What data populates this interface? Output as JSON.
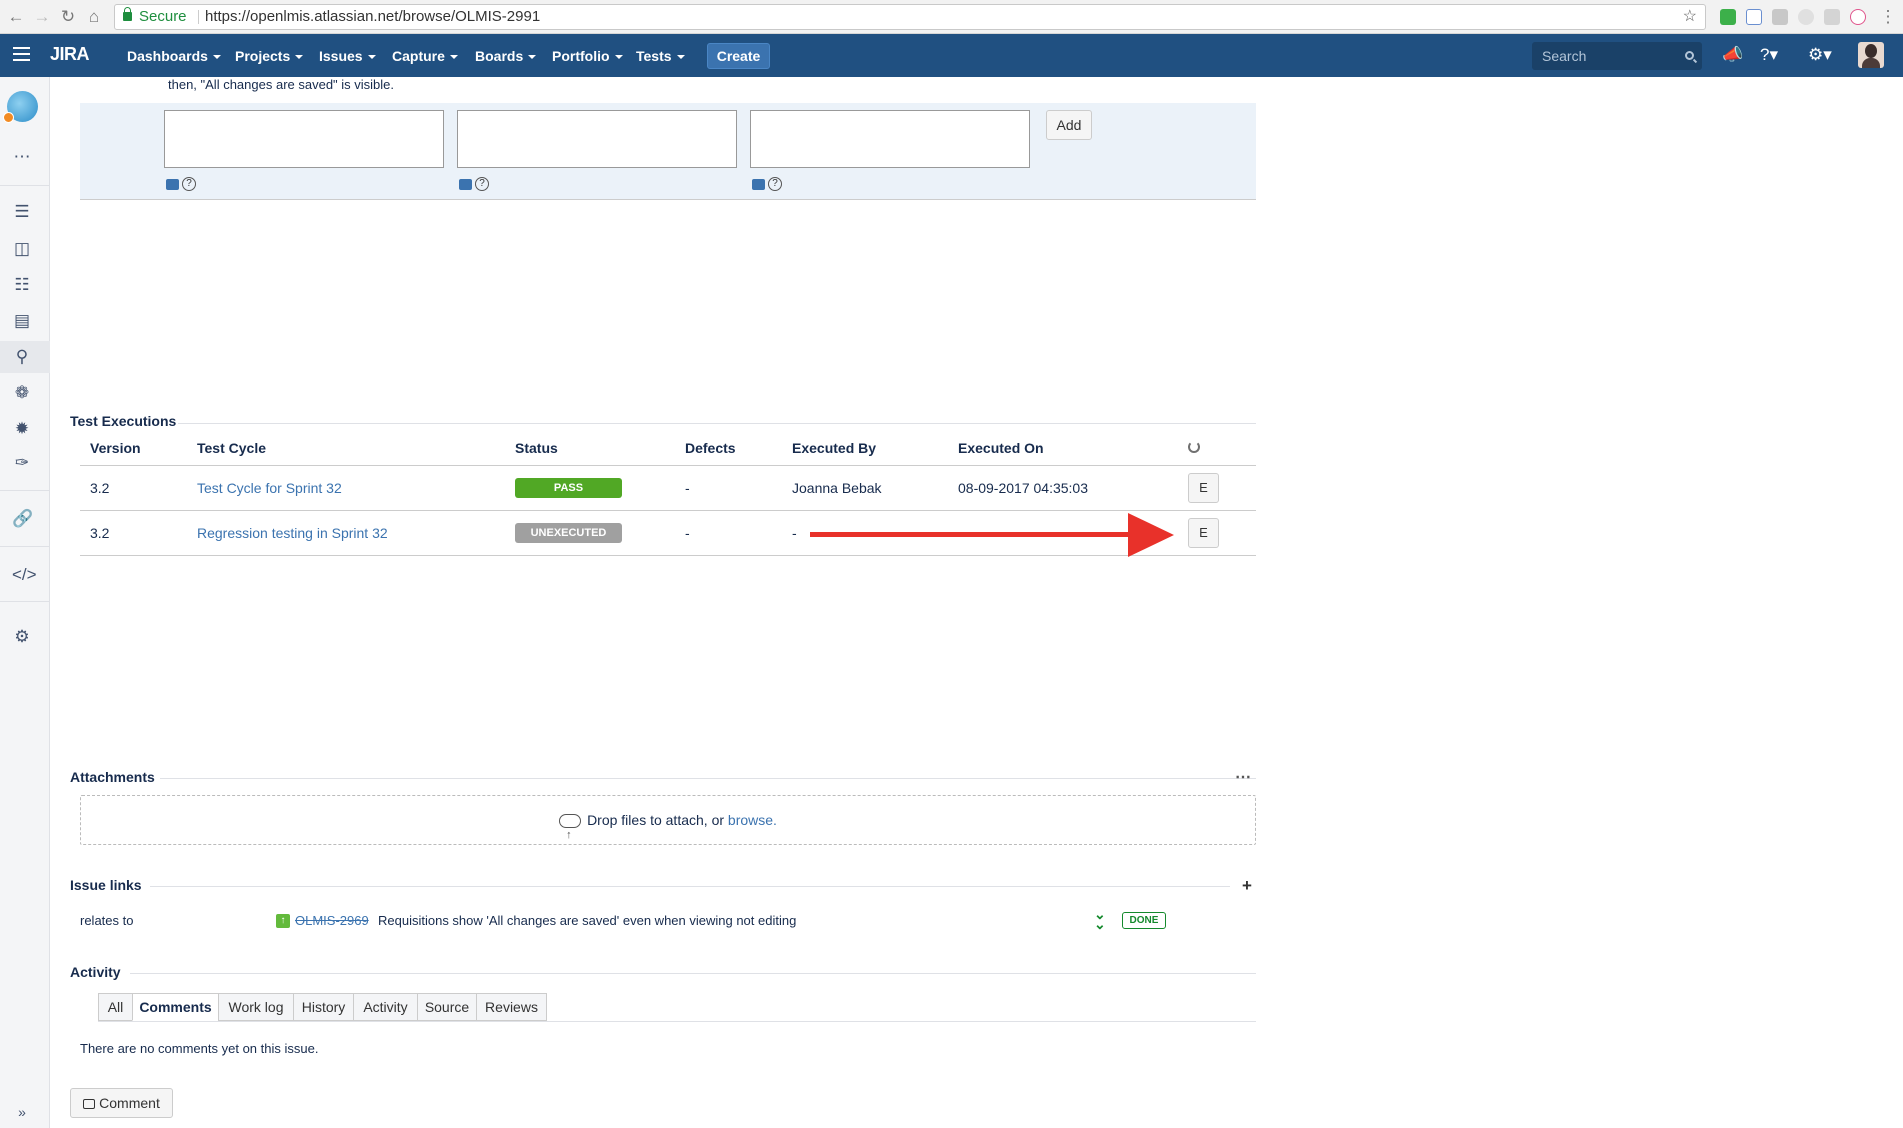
{
  "browser": {
    "secure_label": "Secure",
    "url": "https://openlmis.atlassian.net/browse/OLMIS-2991"
  },
  "nav": {
    "logo": "JIRA",
    "items": [
      "Dashboards",
      "Projects",
      "Issues",
      "Capture",
      "Boards",
      "Portfolio",
      "Tests"
    ],
    "create": "Create",
    "search_placeholder": "Search"
  },
  "sidebar": {
    "icons": [
      "backlog-icon",
      "board-icon",
      "releases-icon",
      "reports-icon",
      "issues-icon",
      "addons-icon",
      "bug-icon",
      "feather-icon",
      "link-icon",
      "code-icon",
      "settings-icon"
    ]
  },
  "step": {
    "text": "then, \"All changes are saved\" is visible.",
    "add_label": "Add"
  },
  "test_executions": {
    "title": "Test Executions",
    "columns": [
      "Version",
      "Test Cycle",
      "Status",
      "Defects",
      "Executed By",
      "Executed On"
    ],
    "rows": [
      {
        "version": "3.2",
        "cycle": "Test Cycle for Sprint 32",
        "status": "PASS",
        "status_color": "#51a825",
        "defects": "-",
        "executed_by": "Joanna Bebak",
        "executed_on": "08-09-2017 04:35:03",
        "action": "E"
      },
      {
        "version": "3.2",
        "cycle": "Regression testing in Sprint 32",
        "status": "UNEXECUTED",
        "status_color": "#a0a0a0",
        "defects": "-",
        "executed_by": "-",
        "executed_on": "",
        "action": "E"
      }
    ]
  },
  "attachments": {
    "title": "Attachments",
    "drop_text": "Drop files to attach, or ",
    "browse": "browse."
  },
  "issue_links": {
    "title": "Issue links",
    "relation": "relates to",
    "key": "OLMIS-2969",
    "summary": "Requisitions show 'All changes are saved' even when viewing not editing",
    "status": "DONE"
  },
  "activity": {
    "title": "Activity",
    "tabs": [
      "All",
      "Comments",
      "Work log",
      "History",
      "Activity",
      "Source",
      "Reviews"
    ],
    "active_tab": "Comments",
    "empty": "There are no comments yet on this issue.",
    "comment_button": "Comment"
  }
}
